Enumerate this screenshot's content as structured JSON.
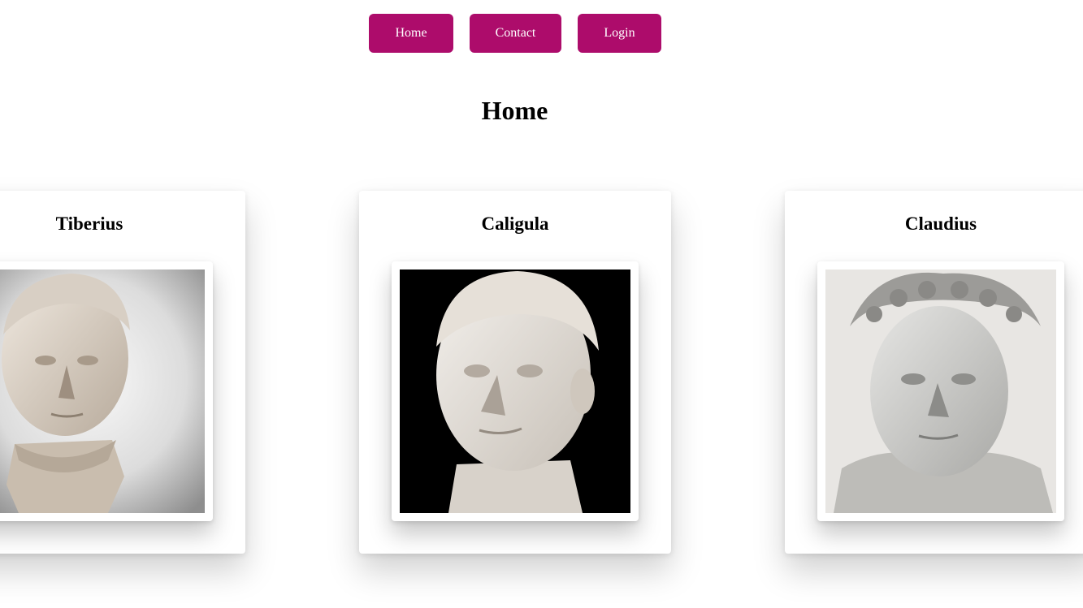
{
  "nav": {
    "items": [
      {
        "label": "Home"
      },
      {
        "label": "Contact"
      },
      {
        "label": "Login"
      }
    ],
    "accent_color": "#ad0c6b"
  },
  "page": {
    "title": "Home"
  },
  "cards": [
    {
      "name": "Tiberius",
      "image": "marble-bust-portrait",
      "background": "gradient-gray"
    },
    {
      "name": "Caligula",
      "image": "marble-bust-portrait",
      "background": "black"
    },
    {
      "name": "Claudius",
      "image": "marble-bust-portrait-with-wreath",
      "background": "light-gray"
    }
  ]
}
